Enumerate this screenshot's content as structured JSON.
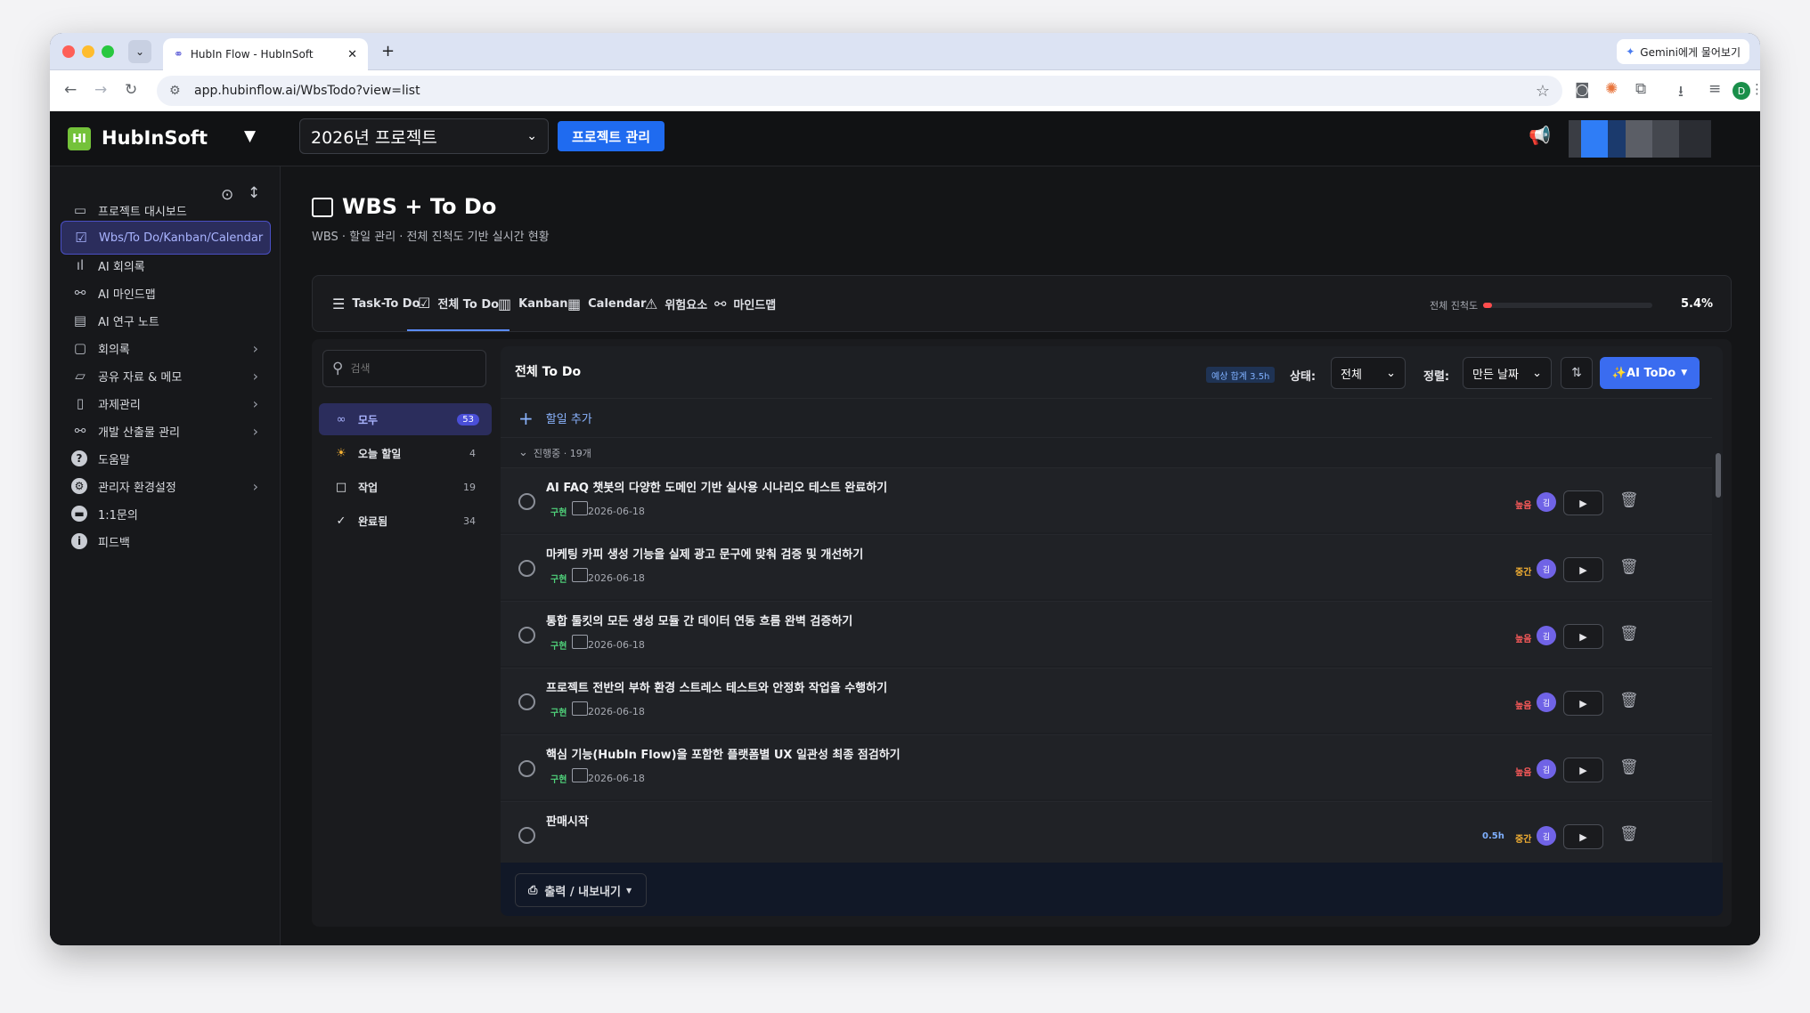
{
  "browser": {
    "tab_title": "HubIn Flow - HubInSoft",
    "new_tab": "+",
    "url": "app.hubinflow.ai/WbsTodo?view=list",
    "gemini_label": "Gemini에게 물어보기",
    "profile_initial": "D"
  },
  "topbar": {
    "brand": "HubInSoft",
    "logo_text": "HI",
    "project_select": "2026년 프로젝트",
    "project_manage": "프로젝트 관리"
  },
  "sidebar": {
    "items": [
      {
        "label": "프로젝트 대시보드",
        "icon": "window-icon"
      },
      {
        "label": "Wbs/To Do/Kanban/Calendar",
        "icon": "check-calendar-icon",
        "active": true
      },
      {
        "label": "AI 회의록",
        "icon": "waveform-icon"
      },
      {
        "label": "AI 마인드맵",
        "icon": "org-chart-icon"
      },
      {
        "label": "AI 연구 노트",
        "icon": "note-icon"
      },
      {
        "label": "회의록",
        "icon": "chat-icon",
        "chevron": true
      },
      {
        "label": "공유 자료 & 메모",
        "icon": "folder-icon",
        "chevron": true
      },
      {
        "label": "과제관리",
        "icon": "clipboard-icon",
        "chevron": true
      },
      {
        "label": "개발 산출물 관리",
        "icon": "hierarchy-icon",
        "chevron": true
      },
      {
        "label": "도움말",
        "icon": "help-icon"
      },
      {
        "label": "관리자 환경설정",
        "icon": "settings-icon",
        "chevron": true
      },
      {
        "label": "1:1문의",
        "icon": "message-icon"
      },
      {
        "label": "피드백",
        "icon": "info-icon"
      }
    ]
  },
  "page": {
    "title": "WBS + To Do",
    "subtitle": "WBS · 할일 관리 · 전체 진척도 기반 실시간 현황"
  },
  "view_tabs": [
    {
      "label": "Task-To Do",
      "icon": "list-icon"
    },
    {
      "label": "전체 To Do",
      "icon": "checkbox-icon",
      "active": true
    },
    {
      "label": "Kanban",
      "icon": "kanban-icon"
    },
    {
      "label": "Calendar",
      "icon": "calendar-icon"
    },
    {
      "label": "위험요소",
      "icon": "warning-icon"
    },
    {
      "label": "마인드맵",
      "icon": "mindmap-icon"
    }
  ],
  "progress": {
    "label": "전체 진척도",
    "value_text": "5.4%",
    "value": 0.054
  },
  "filters": {
    "search_placeholder": "검색",
    "items": [
      {
        "label": "모두",
        "count": "53",
        "icon": "infinity-icon",
        "active": true
      },
      {
        "label": "오늘 할일",
        "count": "4",
        "icon": "sun-icon"
      },
      {
        "label": "작업",
        "count": "19",
        "icon": "square-icon"
      },
      {
        "label": "완료됨",
        "count": "34",
        "icon": "check-icon"
      }
    ]
  },
  "list": {
    "title": "전체 To Do",
    "estimate_badge": "예상 합계 3.5h",
    "status_label": "상태:",
    "status_value": "전체",
    "sort_label": "정렬:",
    "sort_value": "만든 날짜",
    "ai_button": "✨AI ToDo",
    "add_label": "할일 추가",
    "group_label": "진행중 · 19개",
    "export_label": "출력 / 내보내기",
    "rows": [
      {
        "title": "AI FAQ 챗봇의 다양한 도메인 기반 실사용 시나리오 테스트 완료하기",
        "tag": "구현",
        "date": "2026-06-18",
        "priority": "높음",
        "priority_color": "#ff5b5b",
        "avatar": "김"
      },
      {
        "title": "마케팅 카피 생성 기능을 실제 광고 문구에 맞춰 검증 및 개선하기",
        "tag": "구현",
        "date": "2026-06-18",
        "priority": "중간",
        "priority_color": "#f5b133",
        "avatar": "김"
      },
      {
        "title": "통합 툴킷의 모든 생성 모듈 간 데이터 연동 흐름 완벽 검증하기",
        "tag": "구현",
        "date": "2026-06-18",
        "priority": "높음",
        "priority_color": "#ff5b5b",
        "avatar": "김"
      },
      {
        "title": "프로젝트 전반의 부하 환경 스트레스 테스트와 안정화 작업을 수행하기",
        "tag": "구현",
        "date": "2026-06-18",
        "priority": "높음",
        "priority_color": "#ff5b5b",
        "avatar": "김"
      },
      {
        "title": "핵심 기능(HubIn Flow)을 포함한 플랫폼별 UX 일관성 최종 점검하기",
        "tag": "구현",
        "date": "2026-06-18",
        "priority": "높음",
        "priority_color": "#ff5b5b",
        "avatar": "김"
      },
      {
        "title": "판매시작",
        "tag": "",
        "date": "",
        "priority": "중간",
        "priority_color": "#f5b133",
        "avatar": "김",
        "hours": "0.5h"
      }
    ]
  }
}
